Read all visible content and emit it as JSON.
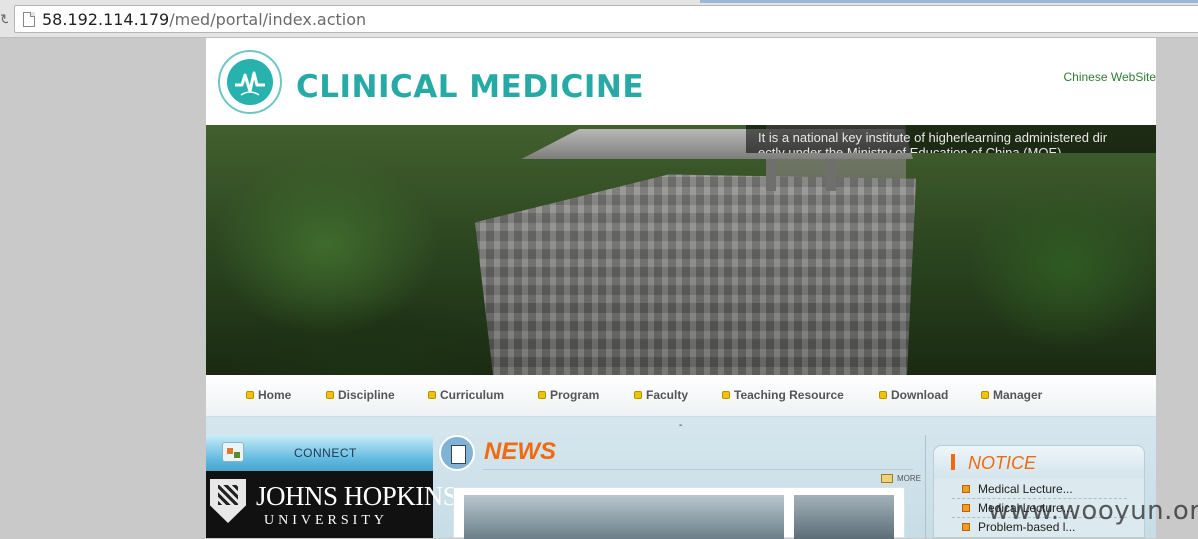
{
  "browser": {
    "url_host": "58.192.114.179",
    "url_path": "/med/portal/index.action"
  },
  "header": {
    "brand": "CLINICAL MEDICINE",
    "chinese_link": "Chinese WebSite",
    "logo_icon": "ecg-heartbeat-logo-icon"
  },
  "banner": {
    "caption_line1": "It is a national key institute of higherlearning administered dir",
    "caption_line2": "ectly under the Ministry of Education of China (MOE)"
  },
  "nav": {
    "items": [
      {
        "label": "Home"
      },
      {
        "label": "Discipline"
      },
      {
        "label": "Curriculum"
      },
      {
        "label": "Program"
      },
      {
        "label": "Faculty"
      },
      {
        "label": "Teaching Resource"
      },
      {
        "label": "Download"
      },
      {
        "label": "Manager"
      }
    ]
  },
  "lower": {
    "dash": "-"
  },
  "connect": {
    "title": "CONNECT",
    "partner_name": "JOHNS HOPKINS",
    "partner_sub": "UNIVERSITY"
  },
  "news": {
    "title": "NEWS",
    "more": "MORE"
  },
  "notice": {
    "title": "NOTICE",
    "items": [
      {
        "label": "Medical Lecture..."
      },
      {
        "label": "Medical Lecture..."
      },
      {
        "label": "Problem-based l..."
      }
    ]
  },
  "watermark": "www.wooyun.org",
  "colors": {
    "brand": "#27aaa6",
    "accent": "#f26a10",
    "link": "#2e7d32"
  }
}
